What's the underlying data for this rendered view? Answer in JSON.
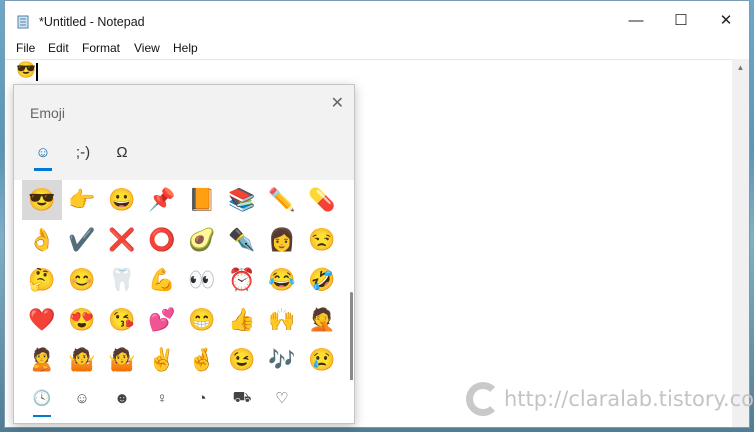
{
  "window": {
    "title": "*Untitled - Notepad",
    "controls": {
      "minimize": "—",
      "maximize": "☐",
      "close": "✕"
    }
  },
  "menu": [
    "File",
    "Edit",
    "Format",
    "View",
    "Help"
  ],
  "editor": {
    "content": "😎"
  },
  "emoji_panel": {
    "title": "Emoji",
    "close": "✕",
    "tabs": [
      {
        "label": "☺",
        "name": "emoji",
        "active": true
      },
      {
        "label": ";-)",
        "name": "kaomoji",
        "active": false
      },
      {
        "label": "Ω",
        "name": "symbols",
        "active": false
      }
    ],
    "emojis": [
      "😎",
      "👉",
      "😀",
      "📌",
      "📙",
      "📚",
      "✏️",
      "💊",
      "👌",
      "✔️",
      "❌",
      "⭕",
      "🥑",
      "✒️",
      "👩",
      "😒",
      "🤔",
      "😊",
      "🦷",
      "💪",
      "👀",
      "⏰",
      "😂",
      "🤣",
      "❤️",
      "😍",
      "😘",
      "💕",
      "😁",
      "👍",
      "🙌",
      "🤦",
      "🙎",
      "🤷",
      "🤷",
      "✌️",
      "🤞",
      "😉",
      "🎶",
      "😢"
    ],
    "categories": [
      {
        "label": "🕓",
        "name": "recent",
        "active": true
      },
      {
        "label": "☺",
        "name": "people",
        "active": false
      },
      {
        "label": "☻",
        "name": "person",
        "active": false
      },
      {
        "label": "♀",
        "name": "celebration",
        "active": false
      },
      {
        "label": "◔",
        "name": "food",
        "active": false
      },
      {
        "label": "⛟",
        "name": "travel",
        "active": false
      },
      {
        "label": "♡",
        "name": "love",
        "active": false
      }
    ]
  },
  "watermark": "http://claralab.tistory.com"
}
